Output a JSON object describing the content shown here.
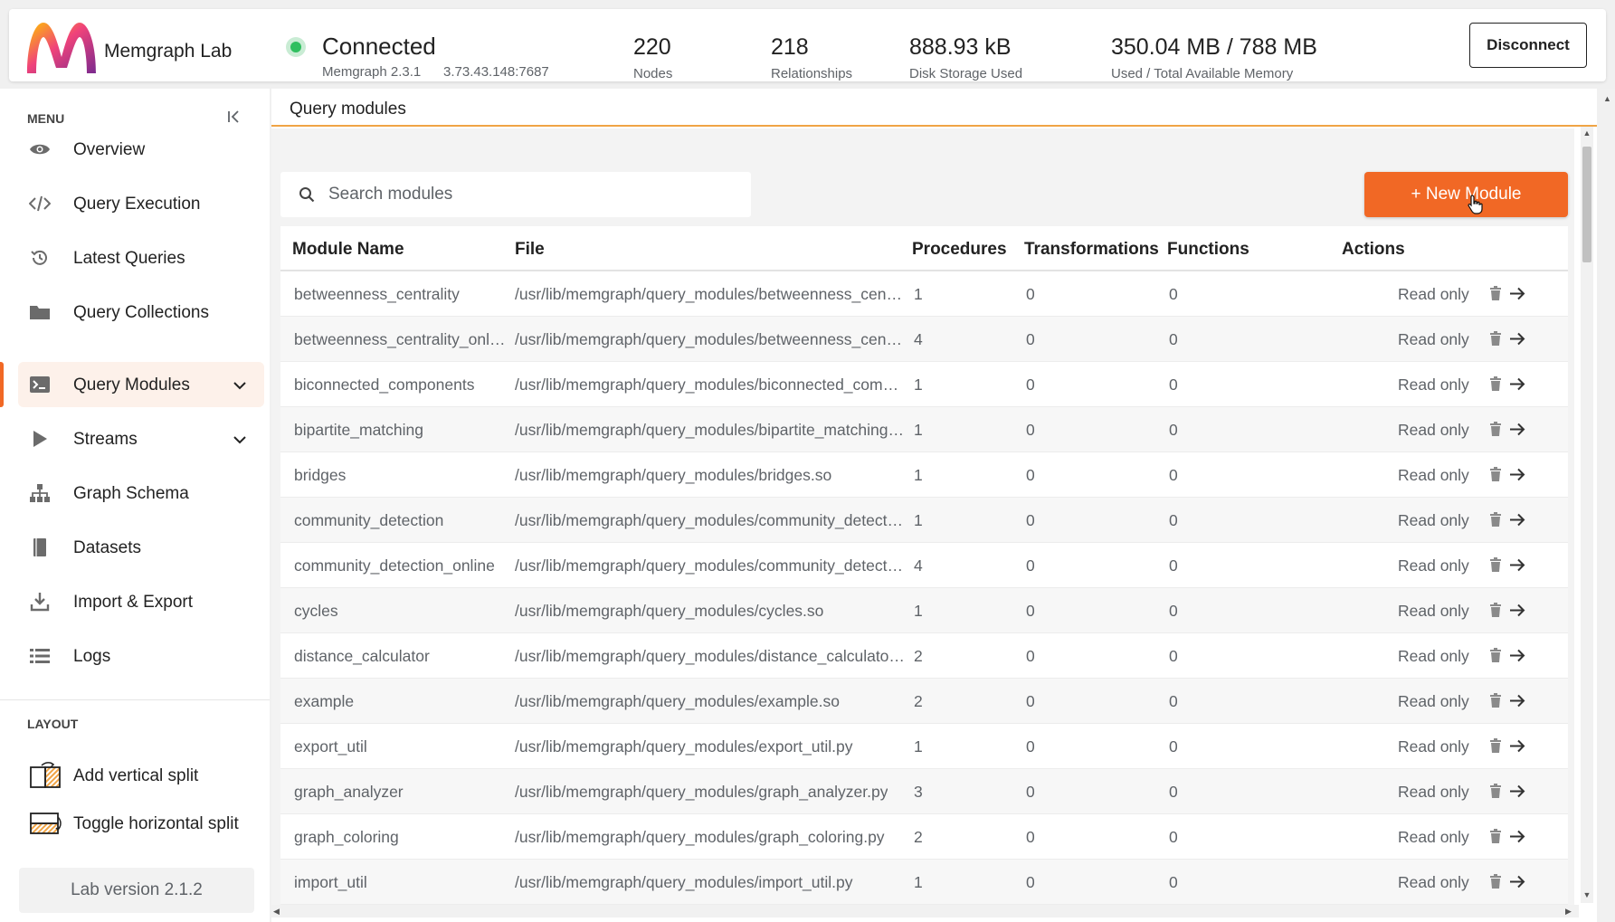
{
  "header": {
    "app_name": "Memgraph Lab",
    "status": "Connected",
    "version": "Memgraph 2.3.1",
    "host": "3.73.43.148:7687",
    "stats": [
      {
        "value": "220",
        "label": "Nodes"
      },
      {
        "value": "218",
        "label": "Relationships"
      },
      {
        "value": "888.93 kB",
        "label": "Disk Storage Used"
      },
      {
        "value": "350.04 MB / 788 MB",
        "label": "Used / Total Available Memory"
      }
    ],
    "disconnect_label": "Disconnect",
    "colors": {
      "connected": "#2fbf5f",
      "accent": "#f16825"
    }
  },
  "sidebar": {
    "menu_heading": "MENU",
    "items": [
      {
        "label": "Overview",
        "icon": "eye-icon"
      },
      {
        "label": "Query Execution",
        "icon": "code-icon"
      },
      {
        "label": "Latest Queries",
        "icon": "history-icon"
      },
      {
        "label": "Query Collections",
        "icon": "folder-icon"
      },
      {
        "label": "Query Modules",
        "icon": "terminal-icon",
        "active": true
      },
      {
        "label": "Streams",
        "icon": "play-icon"
      },
      {
        "label": "Graph Schema",
        "icon": "hierarchy-icon"
      },
      {
        "label": "Datasets",
        "icon": "book-icon"
      },
      {
        "label": "Import & Export",
        "icon": "download-icon"
      },
      {
        "label": "Logs",
        "icon": "list-icon"
      }
    ],
    "layout_heading": "LAYOUT",
    "layout_items": [
      {
        "label": "Add vertical split",
        "icon": "vertical-split-icon"
      },
      {
        "label": "Toggle horizontal split",
        "icon": "horizontal-split-icon"
      }
    ],
    "lab_version": "Lab version 2.1.2"
  },
  "main": {
    "title": "Query modules",
    "search_placeholder": "Search modules",
    "new_module_label": "+ New Module",
    "columns": [
      "Module Name",
      "File",
      "Procedures",
      "Transformations",
      "Functions",
      "Actions"
    ],
    "rows": [
      {
        "name": "betweenness_centrality",
        "file": "/usr/lib/memgraph/query_modules/betweenness_centrality.so",
        "procedures": "1",
        "transformations": "0",
        "functions": "0",
        "access": "Read only"
      },
      {
        "name": "betweenness_centrality_online",
        "file": "/usr/lib/memgraph/query_modules/betweenness_centrality_online.py",
        "procedures": "4",
        "transformations": "0",
        "functions": "0",
        "access": "Read only"
      },
      {
        "name": "biconnected_components",
        "file": "/usr/lib/memgraph/query_modules/biconnected_components.so",
        "procedures": "1",
        "transformations": "0",
        "functions": "0",
        "access": "Read only"
      },
      {
        "name": "bipartite_matching",
        "file": "/usr/lib/memgraph/query_modules/bipartite_matching.so",
        "procedures": "1",
        "transformations": "0",
        "functions": "0",
        "access": "Read only"
      },
      {
        "name": "bridges",
        "file": "/usr/lib/memgraph/query_modules/bridges.so",
        "procedures": "1",
        "transformations": "0",
        "functions": "0",
        "access": "Read only"
      },
      {
        "name": "community_detection",
        "file": "/usr/lib/memgraph/query_modules/community_detection.so",
        "procedures": "1",
        "transformations": "0",
        "functions": "0",
        "access": "Read only"
      },
      {
        "name": "community_detection_online",
        "file": "/usr/lib/memgraph/query_modules/community_detection_online.so",
        "procedures": "4",
        "transformations": "0",
        "functions": "0",
        "access": "Read only"
      },
      {
        "name": "cycles",
        "file": "/usr/lib/memgraph/query_modules/cycles.so",
        "procedures": "1",
        "transformations": "0",
        "functions": "0",
        "access": "Read only"
      },
      {
        "name": "distance_calculator",
        "file": "/usr/lib/memgraph/query_modules/distance_calculator.py",
        "procedures": "2",
        "transformations": "0",
        "functions": "0",
        "access": "Read only"
      },
      {
        "name": "example",
        "file": "/usr/lib/memgraph/query_modules/example.so",
        "procedures": "2",
        "transformations": "0",
        "functions": "0",
        "access": "Read only"
      },
      {
        "name": "export_util",
        "file": "/usr/lib/memgraph/query_modules/export_util.py",
        "procedures": "1",
        "transformations": "0",
        "functions": "0",
        "access": "Read only"
      },
      {
        "name": "graph_analyzer",
        "file": "/usr/lib/memgraph/query_modules/graph_analyzer.py",
        "procedures": "3",
        "transformations": "0",
        "functions": "0",
        "access": "Read only"
      },
      {
        "name": "graph_coloring",
        "file": "/usr/lib/memgraph/query_modules/graph_coloring.py",
        "procedures": "2",
        "transformations": "0",
        "functions": "0",
        "access": "Read only"
      },
      {
        "name": "import_util",
        "file": "/usr/lib/memgraph/query_modules/import_util.py",
        "procedures": "1",
        "transformations": "0",
        "functions": "0",
        "access": "Read only"
      }
    ]
  }
}
